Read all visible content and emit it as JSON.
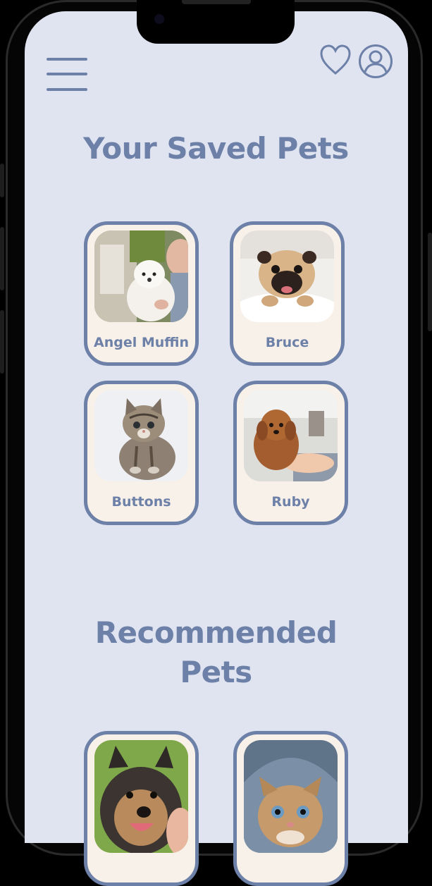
{
  "header": {
    "menu_icon": "hamburger-menu-icon",
    "favorites_icon": "heart-icon",
    "profile_icon": "user-circle-icon"
  },
  "saved_section": {
    "title": "Your Saved Pets",
    "pets": [
      {
        "name": "Angel Muffin",
        "photo": "white-poodle-photo"
      },
      {
        "name": "Bruce",
        "photo": "pug-photo"
      },
      {
        "name": "Buttons",
        "photo": "tabby-kitten-photo"
      },
      {
        "name": "Ruby",
        "photo": "brown-puppy-photo"
      }
    ]
  },
  "recommended_section": {
    "title_line1": "Recommended",
    "title_line2": "Pets",
    "pets": [
      {
        "name": "",
        "photo": "smiling-dog-photo"
      },
      {
        "name": "",
        "photo": "kitten-in-hood-photo"
      }
    ]
  },
  "colors": {
    "screen_background": "#e0e4f1",
    "accent": "#6d80a8",
    "card_background": "#f8f1e9"
  }
}
